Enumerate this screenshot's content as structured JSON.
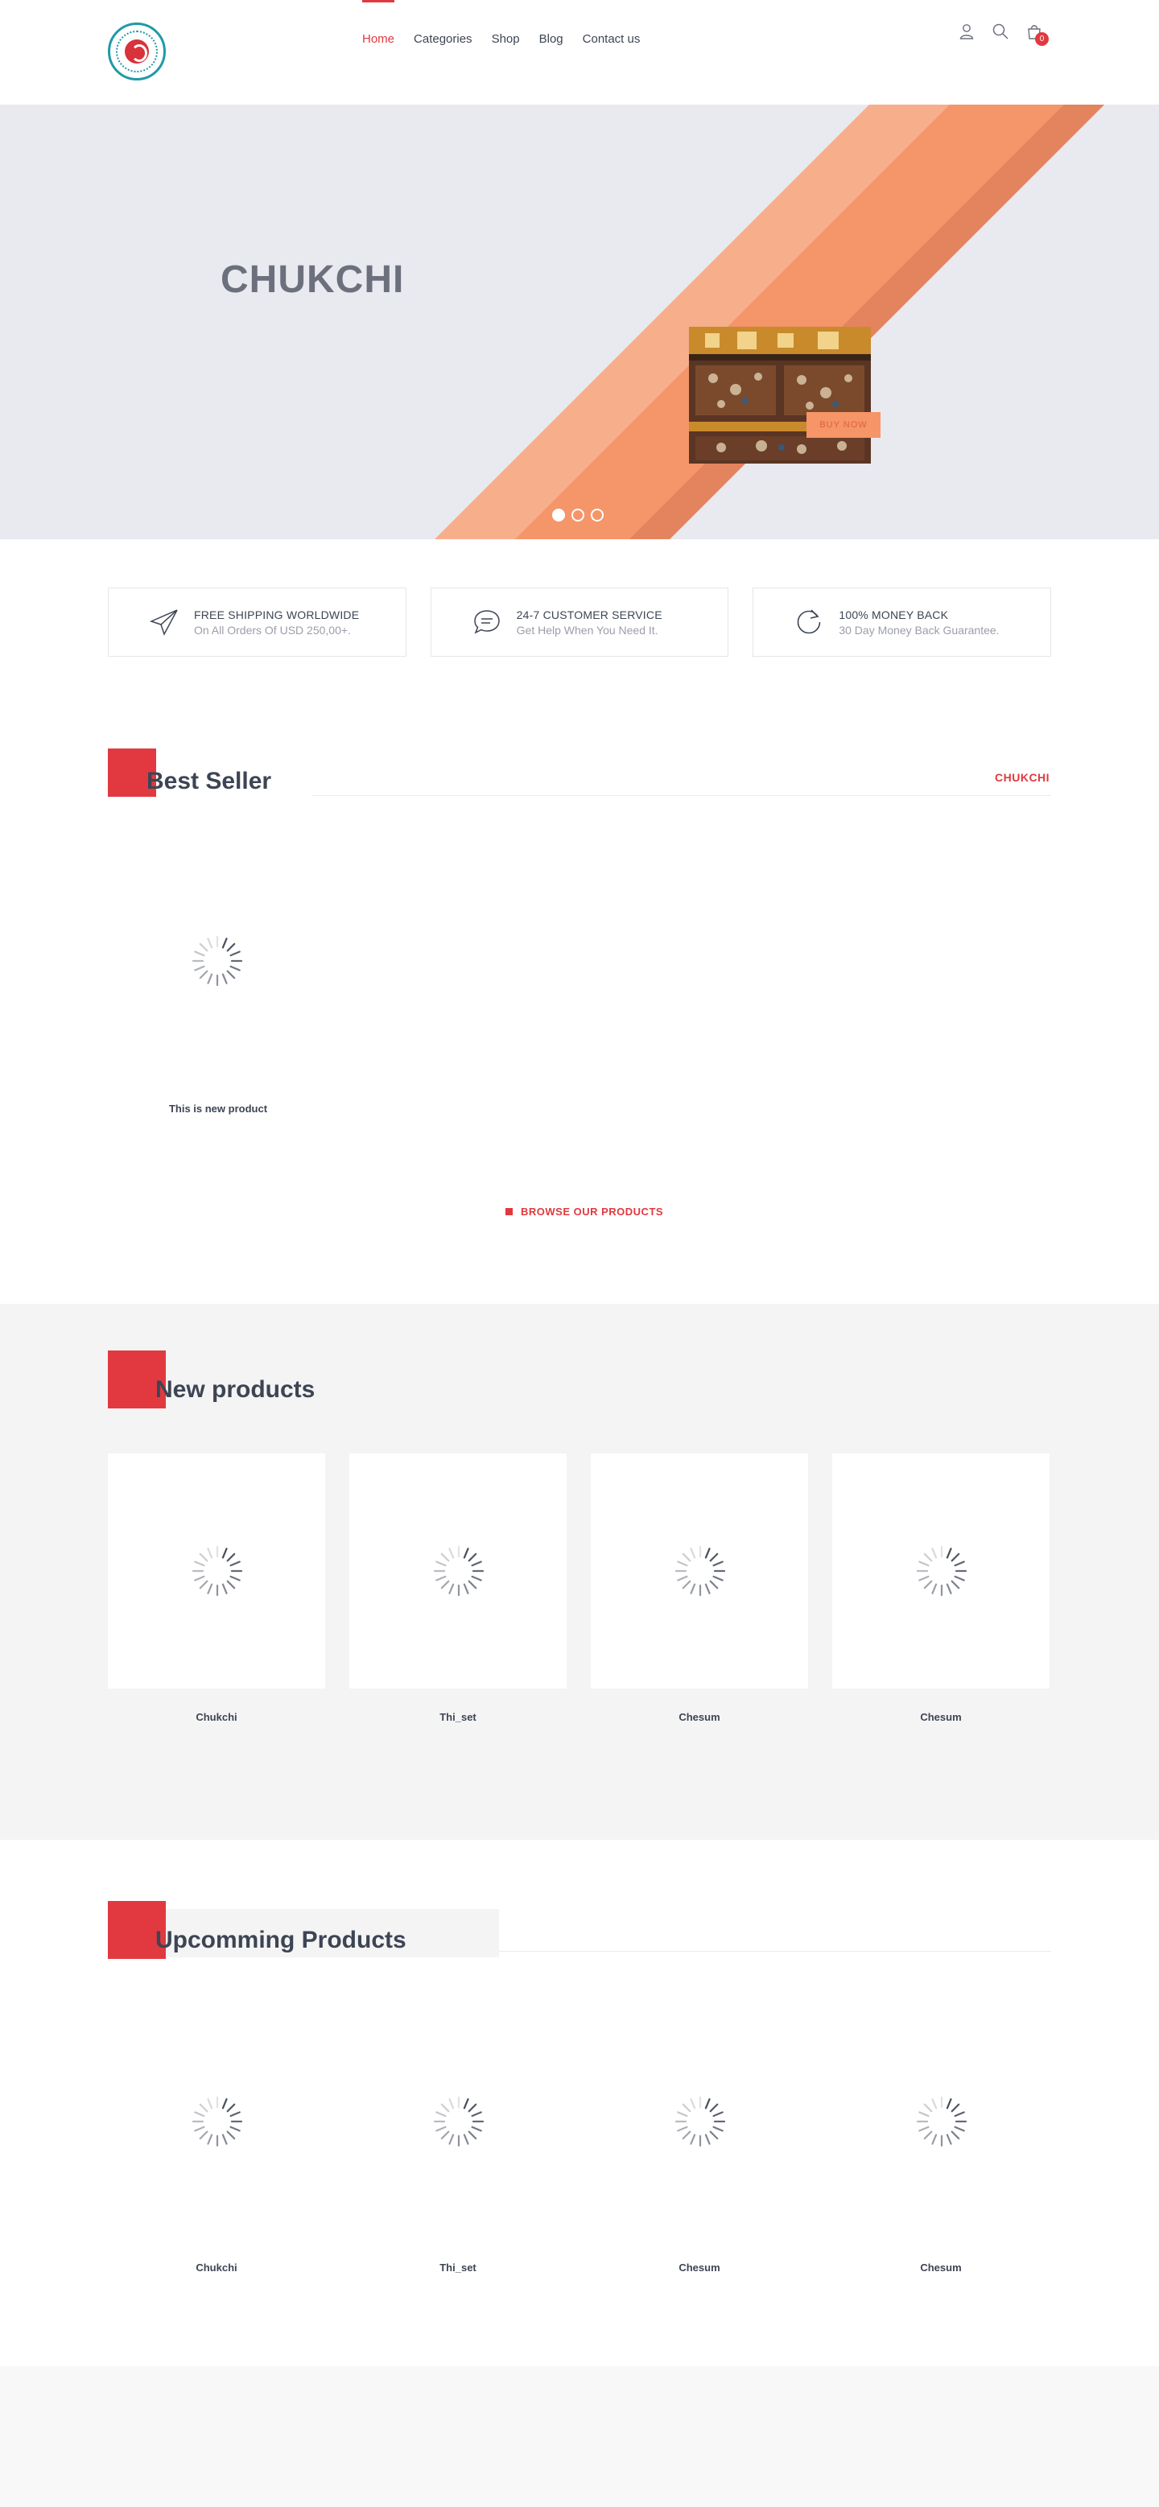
{
  "header": {
    "nav": [
      "Home",
      "Categories",
      "Shop",
      "Blog",
      "Contact us"
    ],
    "active_nav": "Home",
    "cart_count": "0"
  },
  "hero": {
    "title": "CHUKCHI",
    "button": "BUY NOW",
    "slides": 3,
    "active_slide": 1
  },
  "features": [
    {
      "title": "FREE SHIPPING WORLDWIDE",
      "subtitle": "On All Orders Of USD 250,00+.",
      "icon": "paper-plane-icon"
    },
    {
      "title": "24-7 CUSTOMER SERVICE",
      "subtitle": "Get Help When You Need It.",
      "icon": "chat-bubble-icon"
    },
    {
      "title": "100% MONEY BACK",
      "subtitle": "30 Day Money Back Guarantee.",
      "icon": "refresh-icon"
    }
  ],
  "best_seller": {
    "title": "Best Seller",
    "tab": "CHUKCHI",
    "product_name": "This is new product",
    "browse": "BROWSE OUR PRODUCTS"
  },
  "new_products": {
    "title": "New products",
    "items": [
      "Chukchi",
      "Thi_set",
      "Chesum",
      "Chesum"
    ]
  },
  "upcoming": {
    "title": "Upcomming Products",
    "items": [
      "Chukchi",
      "Thi_set",
      "Chesum",
      "Chesum"
    ]
  },
  "colors": {
    "accent": "#e1393f",
    "hero_bg": "#e9e9f0",
    "stripe_light": "#f7ae8b",
    "stripe_mid": "#f5956a",
    "stripe_dark": "#e3845e",
    "section_bg": "#f4f4f5"
  }
}
